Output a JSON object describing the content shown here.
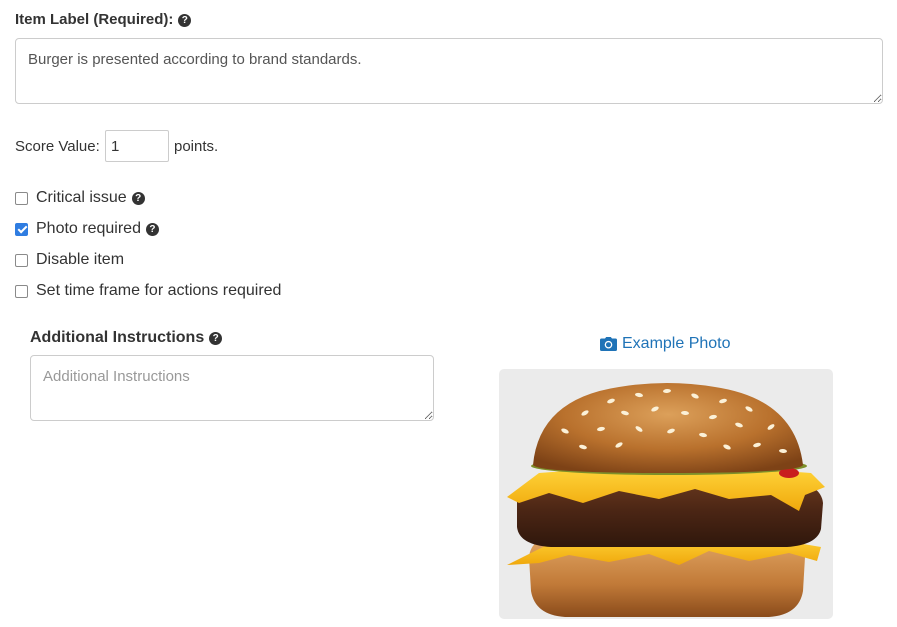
{
  "item_label": {
    "label": "Item Label (Required):",
    "help_icon": "question-circle-icon",
    "value": "Burger is presented according to brand standards."
  },
  "score": {
    "prefix": "Score Value:",
    "value": "1",
    "suffix": "points."
  },
  "options": [
    {
      "label": "Critical issue",
      "checked": false,
      "has_help": true
    },
    {
      "label": "Photo required",
      "checked": true,
      "has_help": true
    },
    {
      "label": "Disable item",
      "checked": false,
      "has_help": false
    },
    {
      "label": "Set time frame for actions required",
      "checked": false,
      "has_help": false
    }
  ],
  "additional": {
    "label": "Additional Instructions",
    "placeholder": "Additional Instructions"
  },
  "example_photo": {
    "link_label": "Example Photo",
    "icon": "camera-icon",
    "image": "cheeseburger-photo"
  },
  "colors": {
    "link": "#1f73b7",
    "checkbox_checked": "#2f7de1",
    "text": "#333333"
  }
}
